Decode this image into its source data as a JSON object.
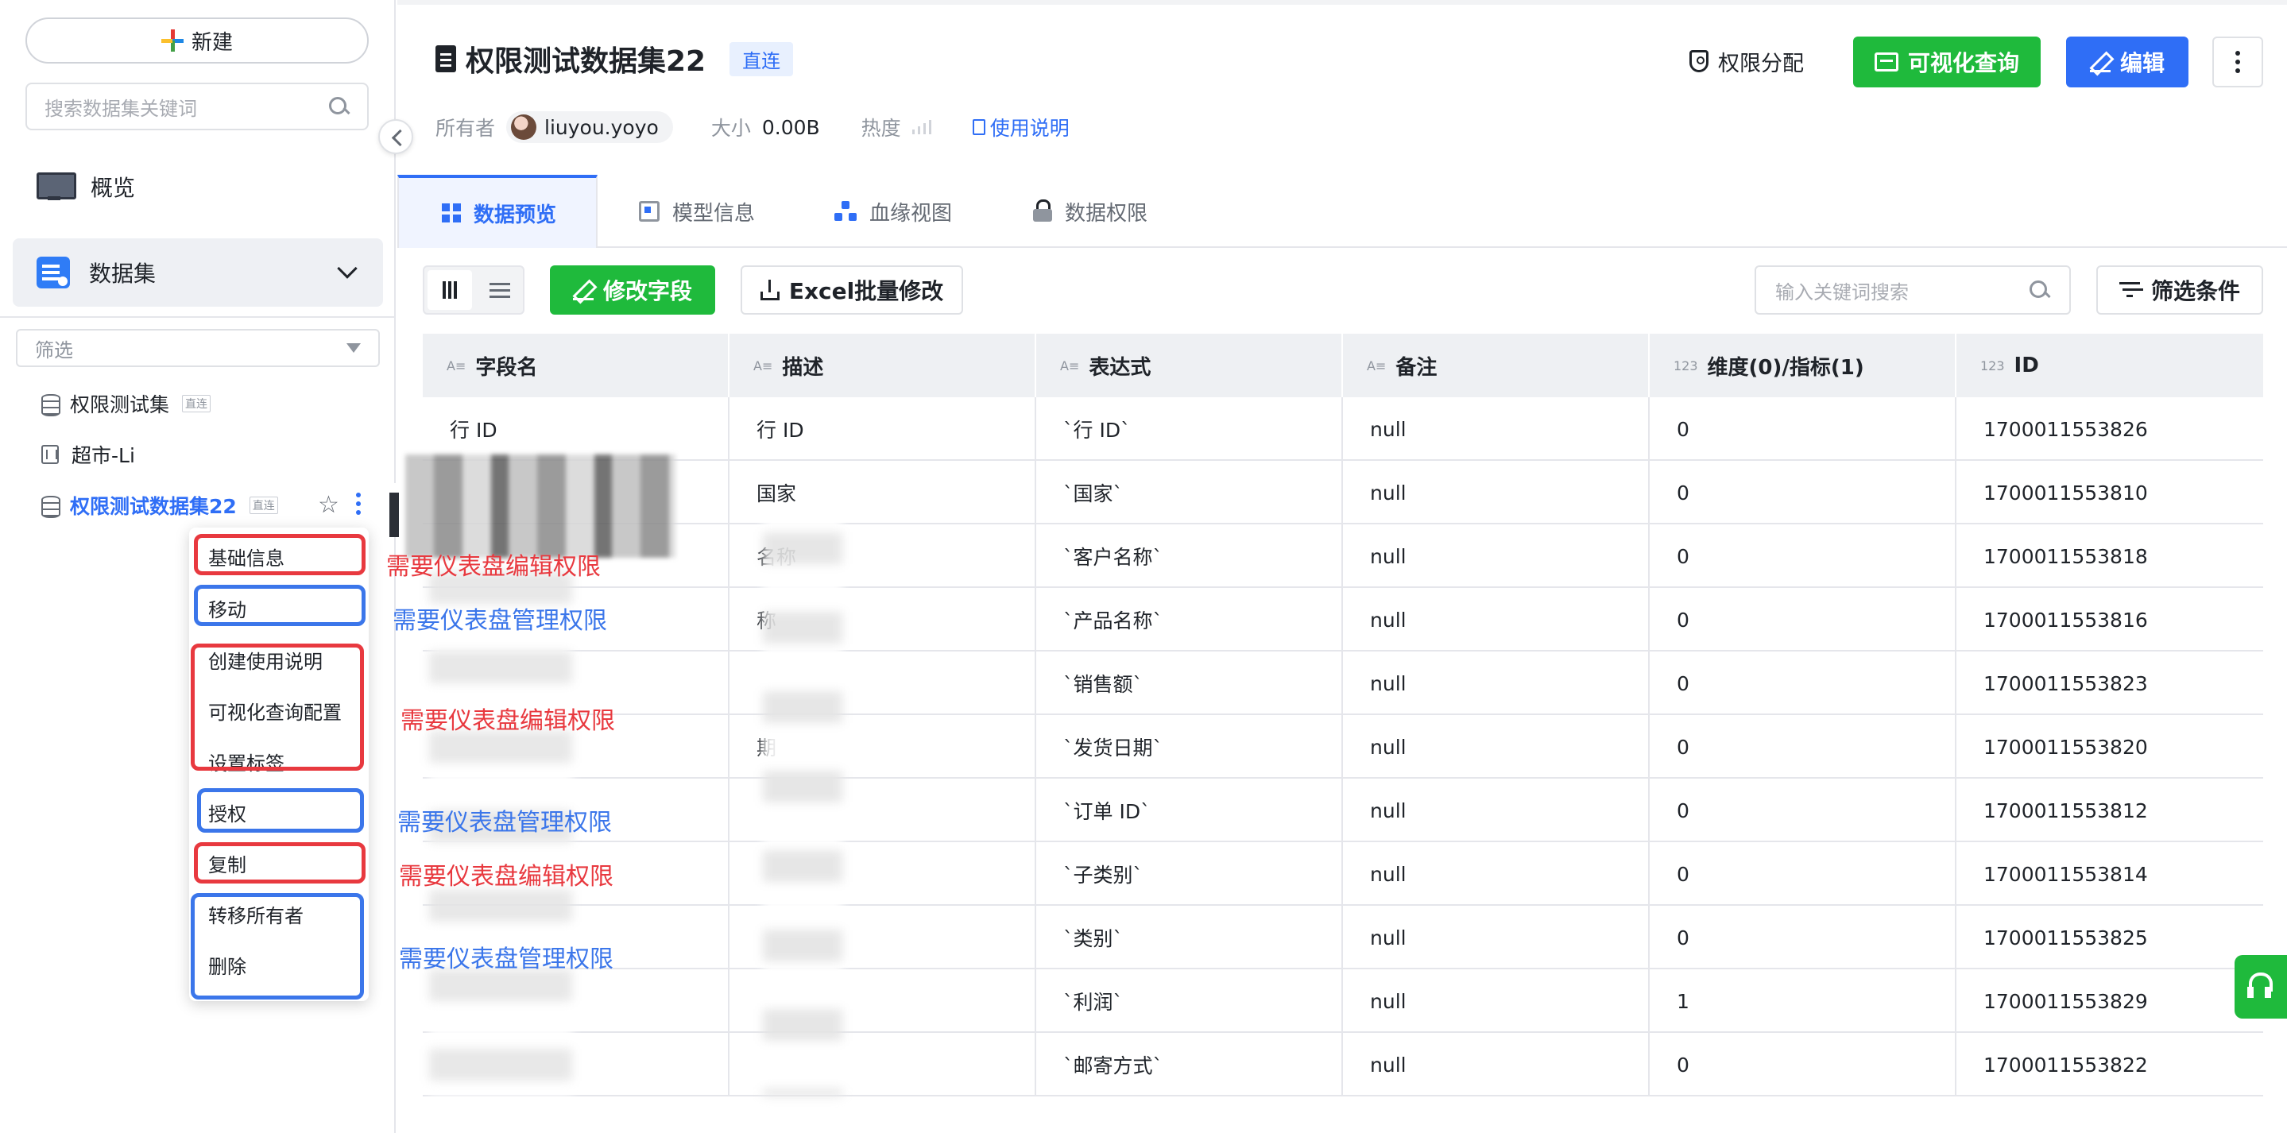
{
  "sidebar": {
    "new_label": "新建",
    "search_placeholder": "搜索数据集关键词",
    "nav_overview": "概览",
    "nav_dataset": "数据集",
    "filter_placeholder": "筛选",
    "tree": [
      {
        "label": "权限测试集",
        "tag": "直连"
      },
      {
        "label": "超市-Li",
        "tag": ""
      },
      {
        "label": "权限测试数据集22",
        "tag": "直连"
      }
    ],
    "context_menu": [
      "基础信息",
      "移动",
      "创建使用说明",
      "可视化查询配置",
      "设置标签",
      "授权",
      "复制",
      "转移所有者",
      "删除"
    ]
  },
  "annotations": {
    "edit_perm": "需要仪表盘编辑权限",
    "manage_perm": "需要仪表盘管理权限",
    "red_color": "#e8393f",
    "blue_color": "#3b76ea"
  },
  "header": {
    "title": "权限测试数据集22",
    "badge": "直连",
    "owner_label": "所有者",
    "owner_name": "liuyou.yoyo",
    "size_label": "大小",
    "size_value": "0.00B",
    "heat_label": "热度",
    "usage_link": "使用说明",
    "perm_button": "权限分配",
    "vis_button": "可视化查询",
    "edit_button": "编辑"
  },
  "tabs": [
    "数据预览",
    "模型信息",
    "血缘视图",
    "数据权限"
  ],
  "toolbar": {
    "modify_button": "修改字段",
    "excel_button": "Excel批量修改",
    "search_placeholder": "输入关键词搜索",
    "filter_button": "筛选条件"
  },
  "table": {
    "headers": [
      {
        "icon": "A≡",
        "label": "字段名"
      },
      {
        "icon": "A≡",
        "label": "描述"
      },
      {
        "icon": "A≡",
        "label": "表达式"
      },
      {
        "icon": "A≡",
        "label": "备注"
      },
      {
        "icon": "123",
        "label": "维度(0)/指标(1)"
      },
      {
        "icon": "123",
        "label": "ID"
      }
    ],
    "rows": [
      [
        "行 ID",
        "行 ID",
        "`行 ID`",
        "null",
        "0",
        "1700011553826"
      ],
      [
        "",
        "国家",
        "`国家`",
        "null",
        "0",
        "1700011553810"
      ],
      [
        "",
        "名称",
        "`客户名称`",
        "null",
        "0",
        "1700011553818"
      ],
      [
        "",
        "称",
        "`产品名称`",
        "null",
        "0",
        "1700011553816"
      ],
      [
        "",
        "",
        "`销售额`",
        "null",
        "0",
        "1700011553823"
      ],
      [
        "",
        "期",
        "`发货日期`",
        "null",
        "0",
        "1700011553820"
      ],
      [
        "",
        "",
        "`订单 ID`",
        "null",
        "0",
        "1700011553812"
      ],
      [
        "",
        "",
        "`子类别`",
        "null",
        "0",
        "1700011553814"
      ],
      [
        "",
        "",
        "`类别`",
        "null",
        "0",
        "1700011553825"
      ],
      [
        "",
        "",
        "`利润`",
        "null",
        "1",
        "1700011553829"
      ],
      [
        "",
        "",
        "`邮寄方式`",
        "null",
        "0",
        "1700011553822"
      ]
    ]
  },
  "colors": {
    "primary_blue": "#2f6ef6",
    "primary_green": "#1fba3c"
  }
}
